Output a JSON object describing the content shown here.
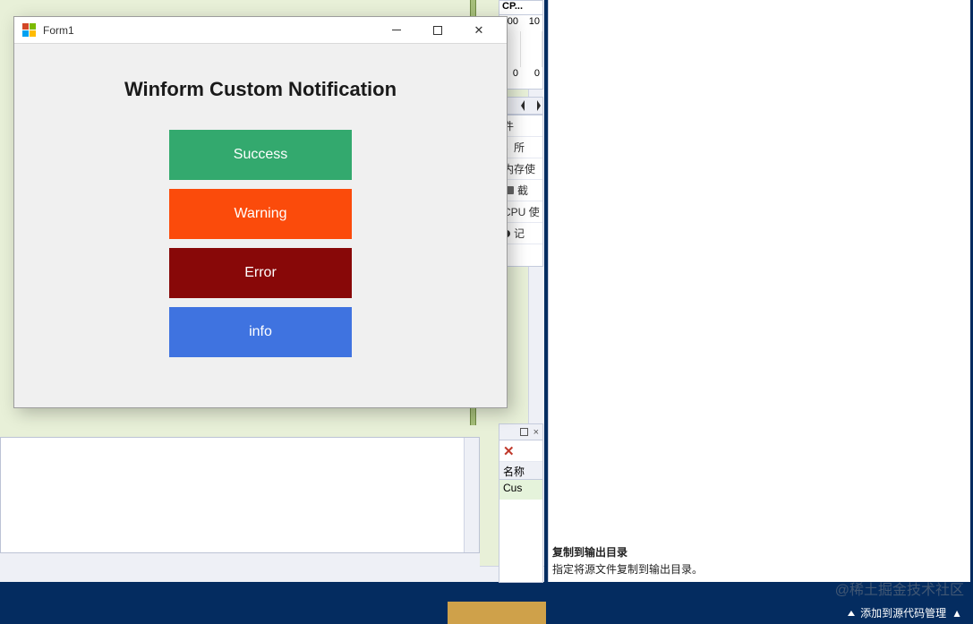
{
  "ide": {
    "cpu_panel": {
      "header": "CP...",
      "val_100a": "00",
      "val_100b": "10",
      "val_0a": "0",
      "val_0b": "0"
    },
    "prop_rows": {
      "r1": "件",
      "r2": "所",
      "r3": "内存使",
      "r4": "截",
      "r5": "CPU 使",
      "r6": "记"
    },
    "toolwin": {
      "grid_header": "名称",
      "grid_value": "Cus"
    },
    "prop_help": {
      "title": "复制到输出目录",
      "desc": "指定将源文件复制到输出目录。"
    },
    "statusbar_right": "添加到源代码管理",
    "watermark": "@稀土掘金技术社区"
  },
  "form1": {
    "title": "Form1",
    "heading": "Winform Custom Notification",
    "buttons": {
      "success": "Success",
      "warning": "Warning",
      "error": "Error",
      "info": "info"
    }
  }
}
